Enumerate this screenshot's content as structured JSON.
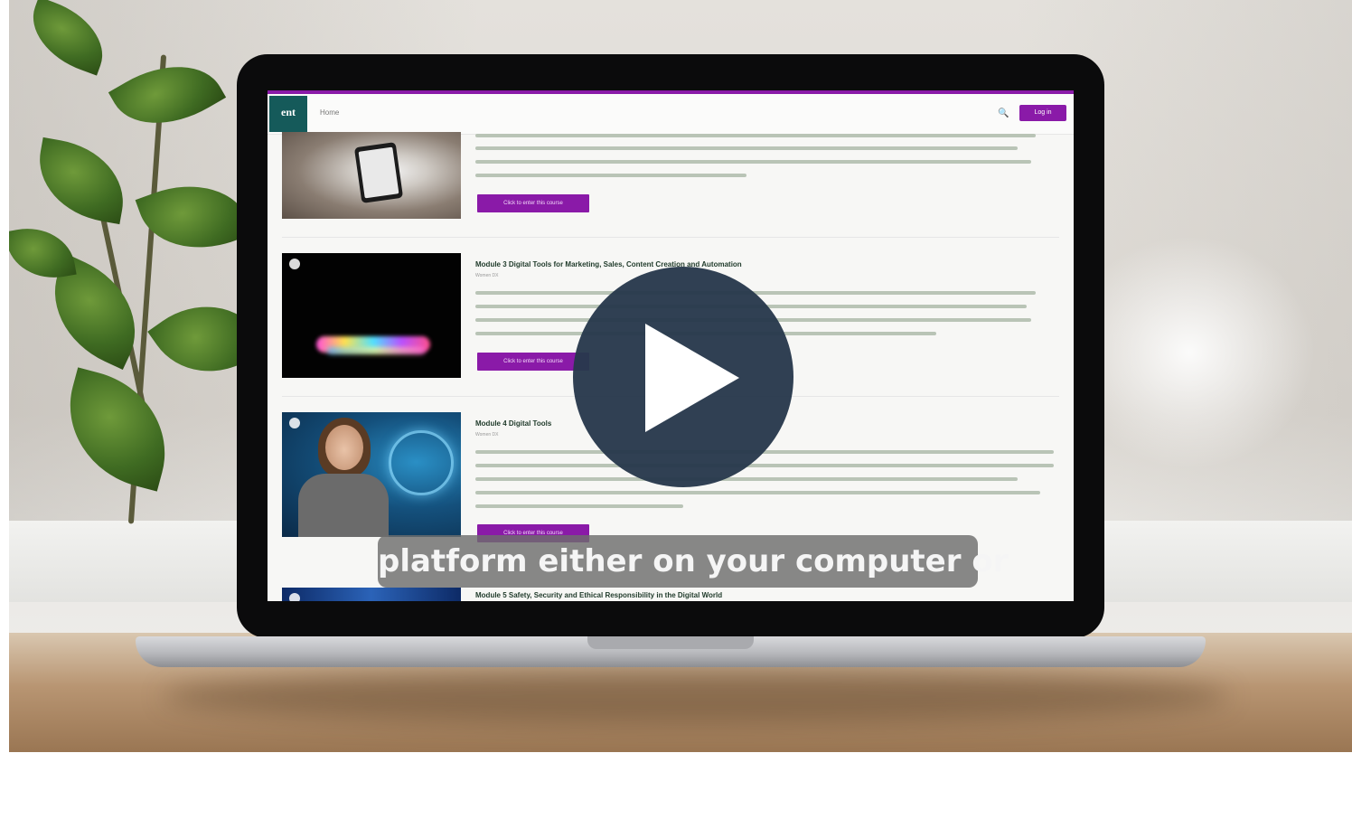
{
  "site": {
    "logo_text": "ent",
    "nav_home": "Home",
    "login_label": "Log in",
    "search_icon": "search-icon"
  },
  "modules": [
    {
      "button_label": "Click to enter this course"
    },
    {
      "title": "Module 3 Digital Tools for Marketing, Sales, Content Creation and Automation",
      "subtitle": "Women DX",
      "button_label": "Click to enter this course"
    },
    {
      "title": "Module 4 Digital Tools",
      "subtitle": "Women DX",
      "button_label": "Click to enter this course"
    },
    {
      "title": "Module 5 Safety, Security and Ethical Responsibility in the Digital World"
    }
  ],
  "video": {
    "caption": "platform either on your computer or",
    "play_icon": "play-icon"
  }
}
